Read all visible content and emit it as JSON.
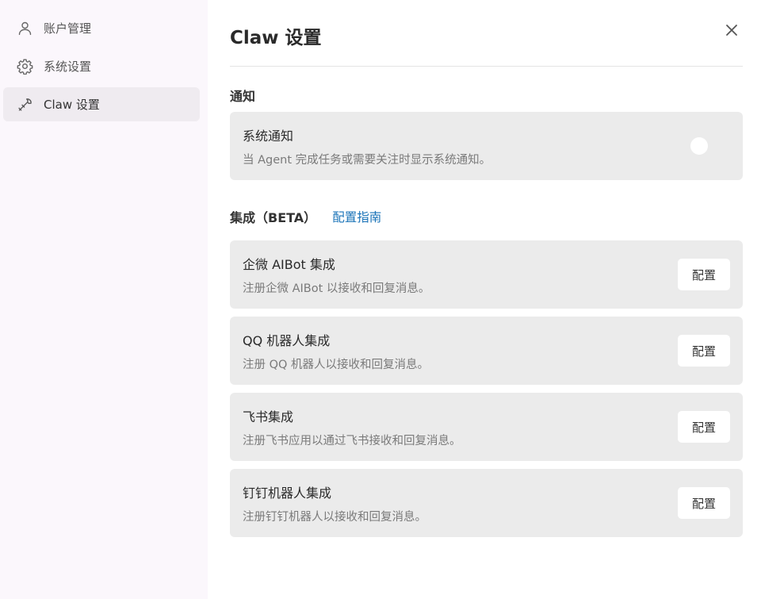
{
  "sidebar": {
    "items": [
      {
        "label": "账户管理",
        "icon": "user-icon"
      },
      {
        "label": "系统设置",
        "icon": "gear-icon"
      },
      {
        "label": "Claw 设置",
        "icon": "wrench-icon",
        "active": true
      }
    ]
  },
  "header": {
    "title": "Claw 设置",
    "close_icon": "close-icon"
  },
  "notification": {
    "section_title": "通知",
    "item_title": "系统通知",
    "item_desc": "当 Agent 完成任务或需要关注时显示系统通知。",
    "toggle_on": false
  },
  "integrations": {
    "section_title": "集成（BETA）",
    "guide_link": "配置指南",
    "items": [
      {
        "title": "企微 AIBot 集成",
        "desc": "注册企微 AIBot 以接收和回复消息。",
        "button": "配置"
      },
      {
        "title": "QQ 机器人集成",
        "desc": "注册 QQ 机器人以接收和回复消息。",
        "button": "配置"
      },
      {
        "title": "飞书集成",
        "desc": "注册飞书应用以通过飞书接收和回复消息。",
        "button": "配置"
      },
      {
        "title": "钉钉机器人集成",
        "desc": "注册钉钉机器人以接收和回复消息。",
        "button": "配置"
      }
    ]
  },
  "colors": {
    "sidebar_bg": "#fbf7fc",
    "card_bg": "#ebebeb",
    "link": "#1a73b8"
  }
}
